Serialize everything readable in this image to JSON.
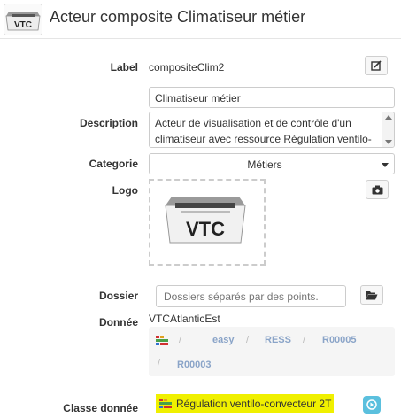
{
  "header": {
    "app_icon_text": "VTC",
    "title": "Acteur composite Climatiseur métier"
  },
  "form": {
    "label": {
      "label": "Label",
      "value": "compositeClim2"
    },
    "title_field": {
      "value": "Climatiseur métier"
    },
    "description": {
      "label": "Description",
      "value": "Acteur de visualisation et de contrôle d'un climatiseur avec ressource Régulation ventilo-"
    },
    "categorie": {
      "label": "Categorie",
      "value": "Métiers"
    },
    "logo": {
      "label": "Logo",
      "image_text": "VTC"
    },
    "dossier": {
      "label": "Dossier",
      "placeholder": "Dossiers séparés par des points."
    },
    "donnee": {
      "label": "Donnée",
      "value": "VTCAtlanticEst",
      "path": [
        "easy",
        "RESS",
        "R00005",
        "R00003"
      ],
      "separator": "/"
    },
    "classe_donnee": {
      "label": "Classe donnée",
      "value": "Régulation ventilo-convecteur 2T"
    }
  },
  "icons": {
    "edit": "edit-icon",
    "camera": "camera-icon",
    "folder": "folder-open-icon",
    "caret": "caret-down-icon",
    "resource": "resource-icon",
    "go": "circle-arrow-icon"
  },
  "colors": {
    "highlight": "#f0f000",
    "accent": "#5bc0de",
    "breadcrumb_link": "#8aa4c8"
  }
}
